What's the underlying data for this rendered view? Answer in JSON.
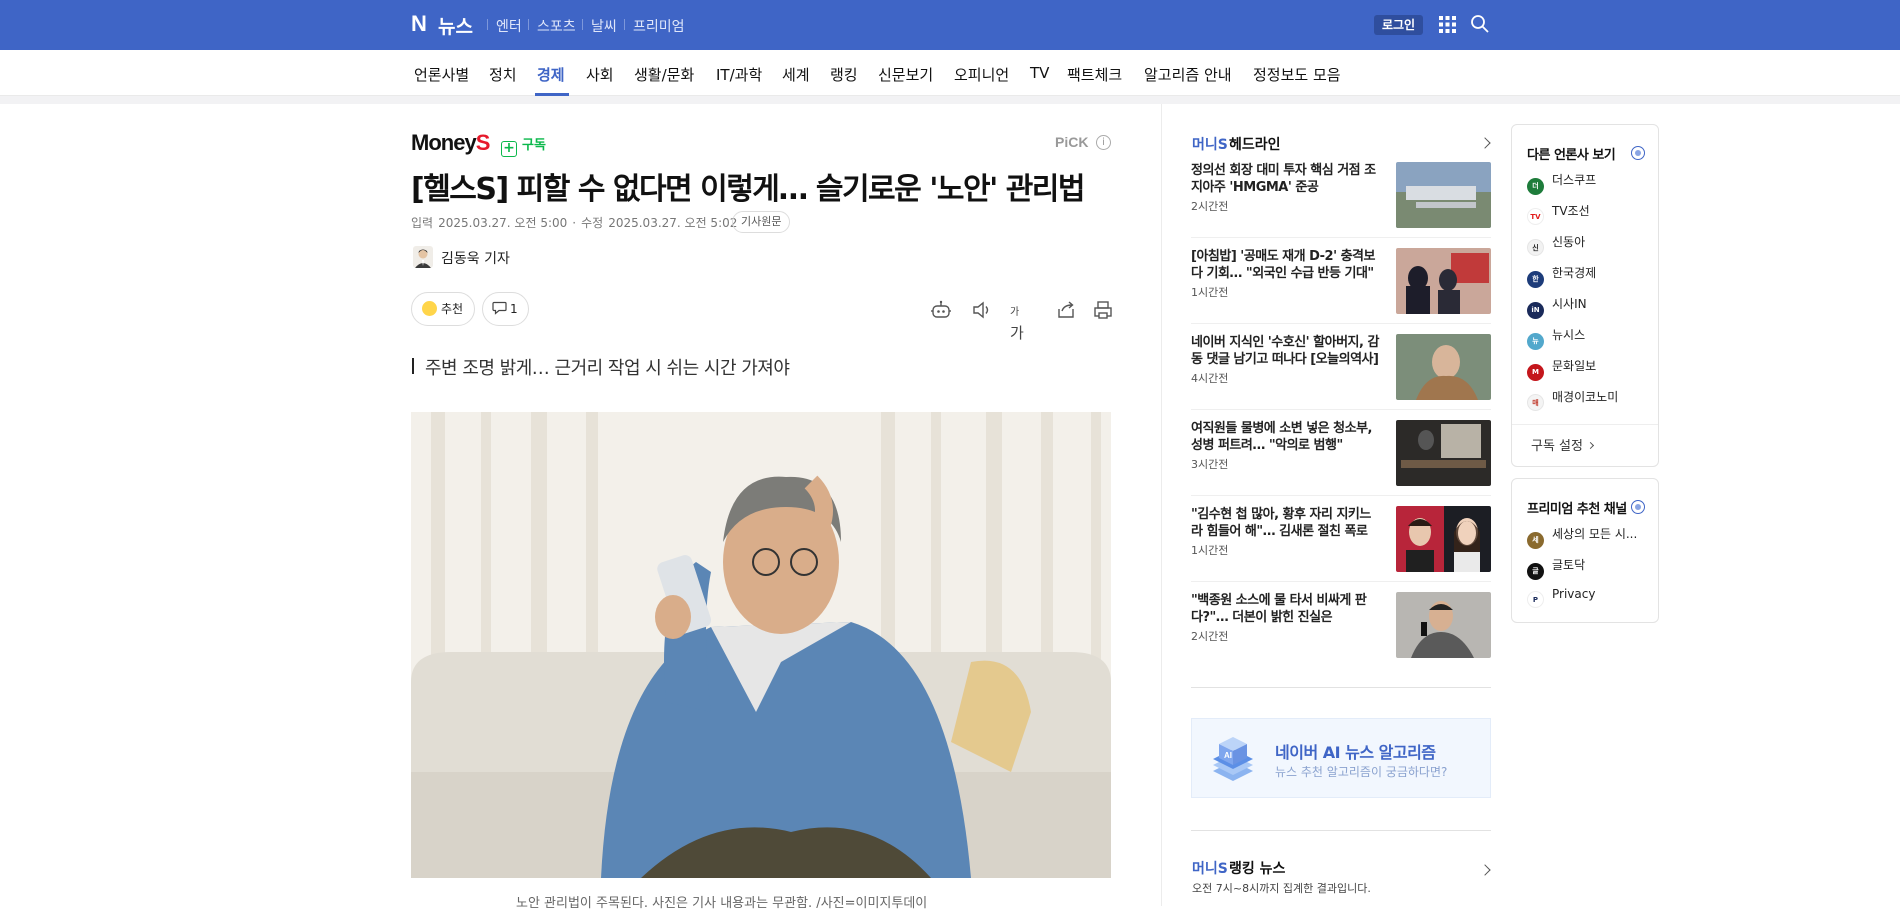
{
  "topbar": {
    "logo_letter": "N",
    "logo_text": "뉴스",
    "menu": [
      "엔터",
      "스포츠",
      "날씨",
      "프리미엄"
    ],
    "login": "로그인"
  },
  "categories": [
    "언론사별",
    "정치",
    "경제",
    "사회",
    "생활/문화",
    "IT/과학",
    "세계",
    "랭킹",
    "신문보기",
    "오피니언",
    "TV",
    "팩트체크",
    "알고리즘 안내",
    "정정보도 모음"
  ],
  "active_category": "경제",
  "article": {
    "press_name_main": "Money",
    "press_name_accent": "S",
    "subscribe": "구독",
    "pick": "PiCK",
    "pick_info": "i",
    "title": "[헬스S] 피할 수 없다면 이렇게… 슬기로운 '노안' 관리법",
    "input_label": "입력",
    "input_date": "2025.03.27. 오전 5:00",
    "edit_label": "수정",
    "edit_date": "2025.03.27. 오전 5:02",
    "original_button": "기사원문",
    "reporter": "김동욱 기자",
    "like_label": "추천",
    "comment_count": "1",
    "font_size_label": "가",
    "subheadline": "주변 조명 밝게… 근거리 작업 시 쉬는 시간 가져야",
    "caption": "노안 관리법이 주목된다. 사진은 기사 내용과는 무관함. /사진=이미지투데이"
  },
  "headlines": {
    "brand": "머니S",
    "title": "헤드라인",
    "items": [
      {
        "title": "정의선 회장 대미 투자 핵심 거점 조지아주 'HMGMA' 준공",
        "time": "2시간전"
      },
      {
        "title": "[아침밥] '공매도 재개 D-2' 충격보다 기회… \"외국인 수급 반등 기대\"",
        "time": "1시간전"
      },
      {
        "title": "네이버 지식인 '수호신' 할아버지, 감동 댓글 남기고 떠나다 [오늘의역사]",
        "time": "4시간전"
      },
      {
        "title": "여직원들 물병에 소변 넣은 청소부, 성병 퍼트려… \"악의로 범행\"",
        "time": "3시간전"
      },
      {
        "title": "\"김수현 첩 많아, 황후 자리 지키느라 힘들어 해\"… 김새론 절친 폭로",
        "time": "1시간전"
      },
      {
        "title": "\"백종원 소스에 물 타서 비싸게 판다?\"… 더본이 밝힌 진실은",
        "time": "2시간전"
      }
    ]
  },
  "ai_banner": {
    "icon_text": "AI",
    "title": "네이버 AI 뉴스 알고리즘",
    "subtitle": "뉴스 추천 알고리즘이 궁금하다면?"
  },
  "ranking": {
    "brand": "머니S",
    "title": "랭킹 뉴스",
    "desc": "오전 7시~8시까지 집계한 결과입니다."
  },
  "other_press": {
    "title": "다른 언론사 보기",
    "items": [
      {
        "name": "더스쿠프",
        "color": "#1e7c3b",
        "abbr": "더"
      },
      {
        "name": "TV조선",
        "color": "#ffffff",
        "abbr": "TV"
      },
      {
        "name": "신동아",
        "color": "#f2f2f2",
        "abbr": "신"
      },
      {
        "name": "한국경제",
        "color": "#1d3c7a",
        "abbr": "한"
      },
      {
        "name": "시사IN",
        "color": "#1a2a5a",
        "abbr": "iN"
      },
      {
        "name": "뉴시스",
        "color": "#52a8cc",
        "abbr": "뉴"
      },
      {
        "name": "문화일보",
        "color": "#c4161c",
        "abbr": "M"
      },
      {
        "name": "매경이코노미",
        "color": "#f4f4f4",
        "abbr": "매"
      }
    ],
    "settings": "구독 설정"
  },
  "premium": {
    "title": "프리미엄 추천 채널",
    "items": [
      {
        "name": "세상의 모든 시...",
        "color": "#8a6a2e",
        "abbr": "세"
      },
      {
        "name": "글토닥",
        "color": "#111111",
        "abbr": "글"
      },
      {
        "name": "Privacy",
        "color": "#ffffff",
        "abbr": "P"
      }
    ]
  },
  "colors": {
    "brand_blue": "#3f65c6",
    "subscribe_green": "#0bb84b",
    "press_red": "#e6192b"
  }
}
